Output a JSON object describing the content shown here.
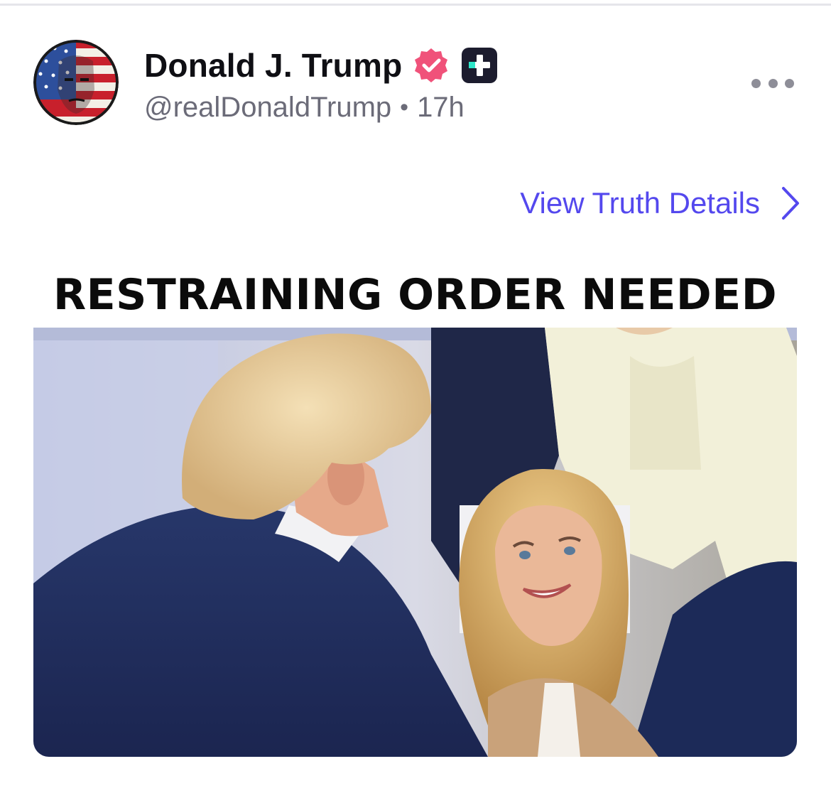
{
  "post": {
    "author": {
      "display_name": "Donald J. Trump",
      "handle": "@realDonaldTrump",
      "separator": "•",
      "timestamp": "17h",
      "verified": true,
      "badge_icon": "plus-badge-icon"
    },
    "view_details_label": "View Truth Details",
    "media": {
      "caption": "RESTRAINING ORDER NEEDED"
    }
  },
  "colors": {
    "accent": "#5448ee",
    "verified_badge": "#f0527a",
    "plus_badge": "#1c1c2e",
    "plus_badge_accent": "#2ee6c9",
    "text_primary": "#0f0f14",
    "text_secondary": "#6b6b78"
  }
}
